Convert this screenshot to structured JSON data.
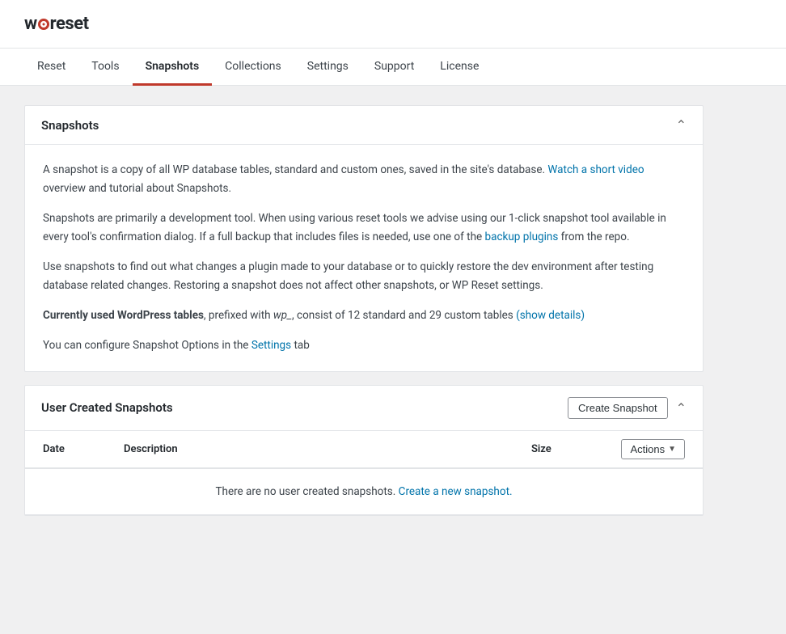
{
  "logo": {
    "text_before": "w",
    "text_after": "reset"
  },
  "nav": {
    "items": [
      {
        "id": "reset",
        "label": "Reset",
        "active": false
      },
      {
        "id": "tools",
        "label": "Tools",
        "active": false
      },
      {
        "id": "snapshots",
        "label": "Snapshots",
        "active": true
      },
      {
        "id": "collections",
        "label": "Collections",
        "active": false
      },
      {
        "id": "settings",
        "label": "Settings",
        "active": false
      },
      {
        "id": "support",
        "label": "Support",
        "active": false
      },
      {
        "id": "license",
        "label": "License",
        "active": false
      }
    ]
  },
  "snapshots_card": {
    "title": "Snapshots",
    "para1_before": "A snapshot is a copy of all WP database tables, standard and custom ones, saved in the site's database. ",
    "para1_link_text": "Watch a short video",
    "para1_after": " overview and tutorial about Snapshots.",
    "para2_before": "Snapshots are primarily a development tool. When using various reset tools we advise using our 1-click snapshot tool available in every tool's confirmation dialog. If a full backup that includes files is needed, use one of the ",
    "para2_link_text": "backup plugins",
    "para2_after": " from the repo.",
    "para3": "Use snapshots to find out what changes a plugin made to your database or to quickly restore the dev environment after testing database related changes. Restoring a snapshot does not affect other snapshots, or WP Reset settings.",
    "para4_before": "Currently used WordPress tables",
    "para4_middle": ", prefixed with ",
    "para4_wp": "wp_",
    "para4_after": ", consist of 12 standard and 29 custom tables ",
    "para4_link_text": "(show details)",
    "para4_end": "",
    "para5_before": "You can configure Snapshot Options in the ",
    "para5_link_text": "Settings",
    "para5_after": " tab"
  },
  "user_snapshots_card": {
    "title": "User Created Snapshots",
    "create_button_label": "Create Snapshot",
    "table": {
      "col_date": "Date",
      "col_description": "Description",
      "col_size": "Size",
      "col_actions": "Actions",
      "empty_message_before": "There are no user created snapshots. ",
      "empty_link_text": "Create a new snapshot.",
      "rows": []
    }
  }
}
